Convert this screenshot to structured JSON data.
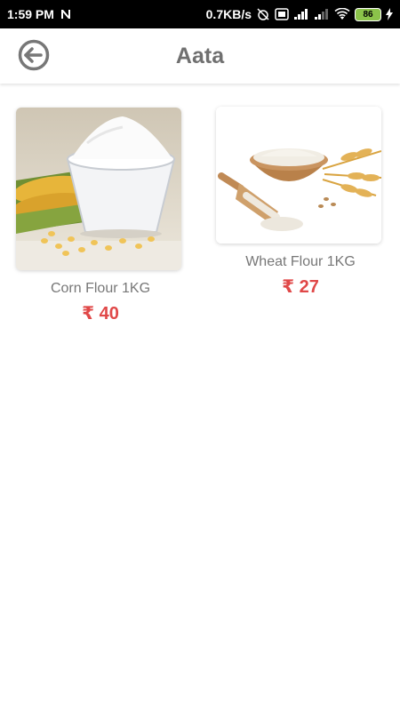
{
  "status_bar": {
    "time": "1:59 PM",
    "network_speed": "0.7KB/s",
    "battery": "86"
  },
  "header": {
    "title": "Aata",
    "back_icon": "back-arrow-circle-icon"
  },
  "products": [
    {
      "name": "Corn Flour 1KG",
      "price": "₹ 40"
    },
    {
      "name": "Wheat Flour 1KG",
      "price": "₹ 27"
    }
  ],
  "colors": {
    "price": "#e04848",
    "title": "#707070",
    "status_bar": "#000000"
  }
}
